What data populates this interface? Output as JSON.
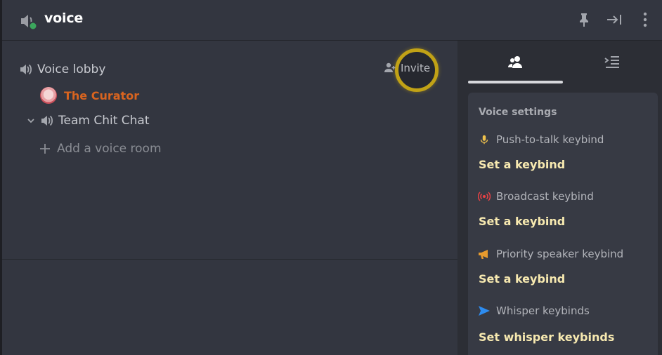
{
  "header": {
    "title": "voice",
    "icons": [
      "speaker-icon",
      "pin-icon",
      "collapse-panel-icon",
      "more-vertical-icon"
    ],
    "status_color": "#3ba55c"
  },
  "rooms": {
    "lobby_label": "Voice lobby",
    "invite_label": "Invite",
    "member_name": "The Curator",
    "member_color": "#d9641f",
    "second_room_label": "Team Chit Chat",
    "add_room_label": "Add a voice room"
  },
  "side_panel": {
    "tabs": [
      "people-icon",
      "collapse-list-icon"
    ],
    "settings_title": "Voice settings",
    "keybinds": [
      {
        "label": "Push-to-talk keybind",
        "action": "Set a keybind",
        "icon": "microphone-icon",
        "icon_color": "#f0c24c"
      },
      {
        "label": "Broadcast keybind",
        "action": "Set a keybind",
        "icon": "broadcast-icon",
        "icon_color": "#ed4245"
      },
      {
        "label": "Priority speaker keybind",
        "action": "Set a keybind",
        "icon": "megaphone-icon",
        "icon_color": "#e69a2e"
      },
      {
        "label": "Whisper keybinds",
        "action": "Set whisper keybinds",
        "icon": "send-icon",
        "icon_color": "#2d8cf0"
      }
    ]
  }
}
